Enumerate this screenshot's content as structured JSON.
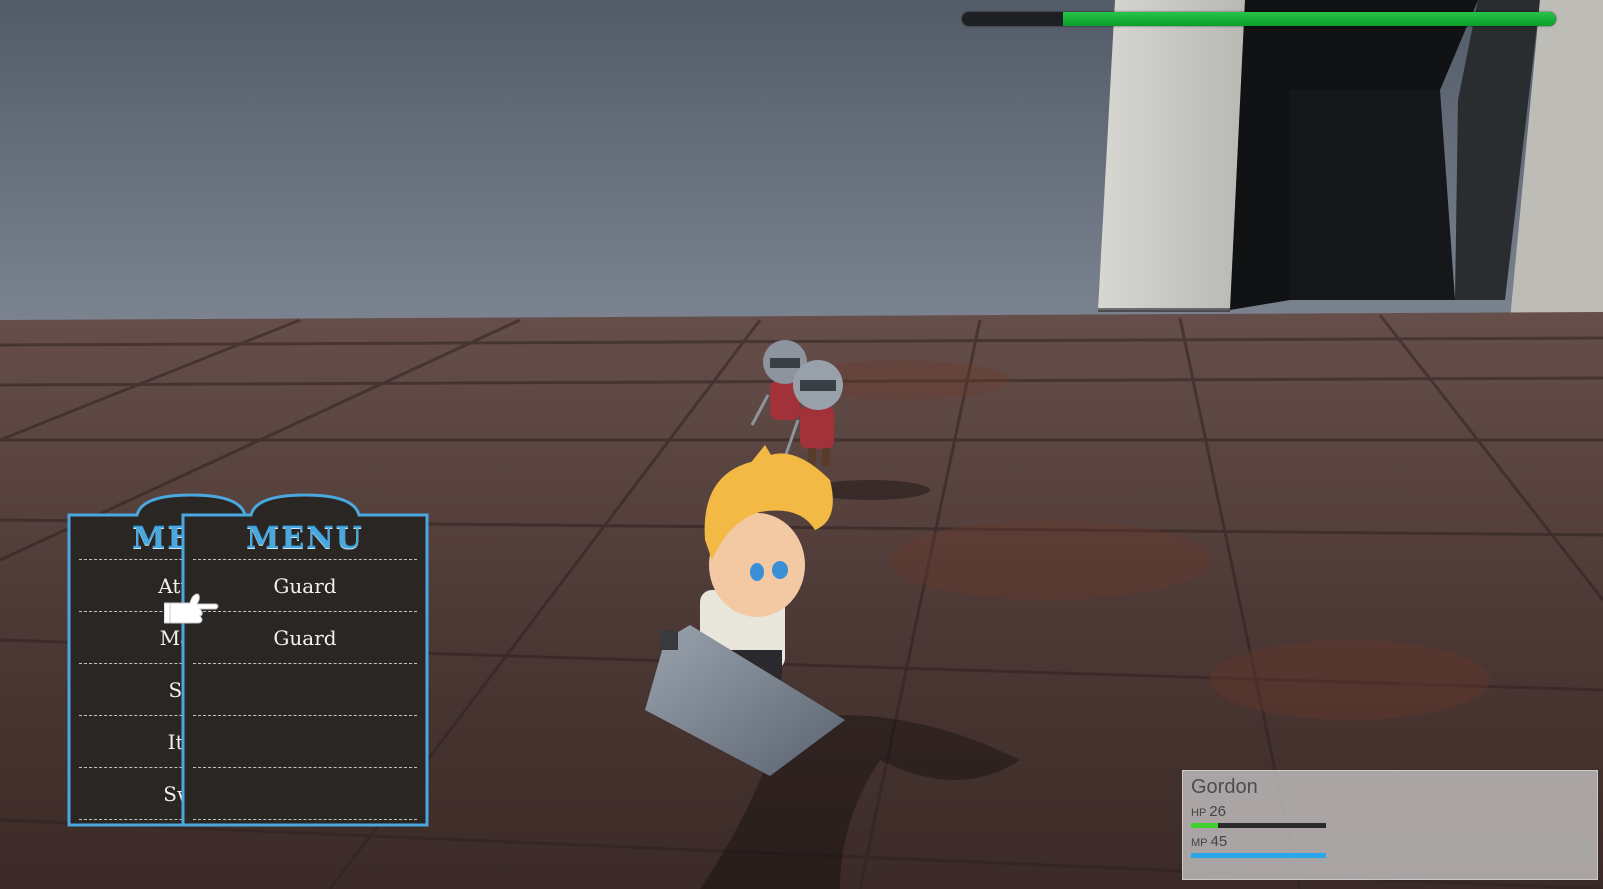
{
  "enemy_health": {
    "fraction": 0.83,
    "color": "#10b22f"
  },
  "menu_back": {
    "title": "MENU",
    "items": [
      "Attack",
      "Magic",
      "Skill",
      "Item",
      "Swap"
    ]
  },
  "menu_front": {
    "title": "MENU",
    "items": [
      "Guard",
      "Guard",
      "",
      "",
      ""
    ]
  },
  "party": {
    "name": "Gordon",
    "hp_label": "HP",
    "hp": "26",
    "hp_fraction": 0.2,
    "mp_label": "MP",
    "mp": "45",
    "mp_fraction": 1.0
  },
  "colors": {
    "menu_border": "#4aa8de",
    "menu_bg": "#2a2624",
    "hp": "#3fd12f",
    "mp": "#2aa6ea"
  },
  "icons": {
    "pointer": "pointing-hand-icon"
  }
}
